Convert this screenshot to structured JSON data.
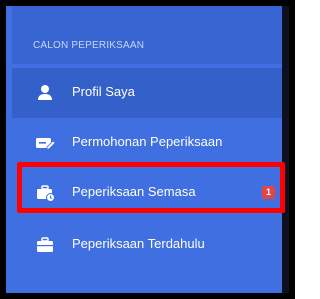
{
  "sidebar": {
    "section_title": "CALON PEPERIKSAAN",
    "items": [
      {
        "label": "Profil Saya",
        "icon": "user-icon"
      },
      {
        "label": "Permohonan Peperiksaan",
        "icon": "edit-card-icon"
      },
      {
        "label": "Peperiksaan Semasa",
        "icon": "briefcase-clock-icon",
        "badge": "1"
      },
      {
        "label": "Peperiksaan Terdahulu",
        "icon": "briefcase-icon"
      }
    ]
  },
  "colors": {
    "sidebar_bg": "#3f6fe0",
    "header_bg": "#3766d3",
    "text": "#ffffff",
    "badge": "#e24545",
    "highlight": "#ff0000"
  }
}
